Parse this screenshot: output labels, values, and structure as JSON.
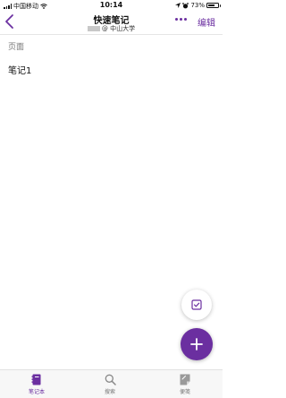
{
  "status_bar": {
    "carrier": "中国移动",
    "time": "10:14",
    "battery_percent": "73%",
    "battery_level": 0.73
  },
  "nav": {
    "title": "快速笔记",
    "subtitle": "@ 中山大学",
    "edit_label": "编辑"
  },
  "section_label": "页面",
  "pages": [
    {
      "title": "笔记1"
    }
  ],
  "tabs": [
    {
      "label": "笔记本",
      "icon": "notebook-icon",
      "active": true
    },
    {
      "label": "搜索",
      "icon": "search-icon",
      "active": false
    },
    {
      "label": "便笺",
      "icon": "sticky-note-icon",
      "active": false
    }
  ],
  "colors": {
    "accent": "#6b2fa0"
  }
}
